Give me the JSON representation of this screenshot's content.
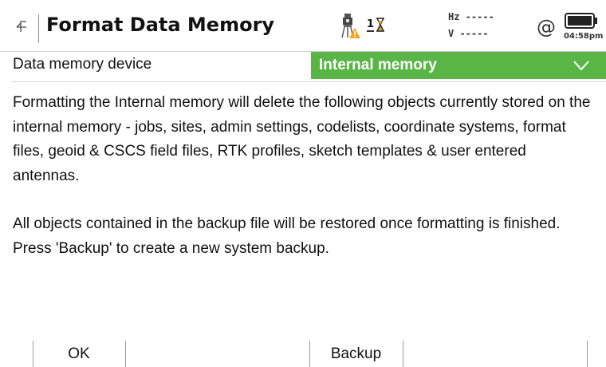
{
  "title_bar": {
    "back_icon": "back-arrow-icon",
    "title": "Format Data Memory",
    "status": {
      "sensor_icon": "instrument-warning-icon",
      "count": "1",
      "hourglass_icon": "hourglass-icon",
      "hz_label": "Hz -----",
      "v_label": "V  -----",
      "at_symbol": "@",
      "battery_icon": "battery-icon",
      "time": "04:58pm"
    }
  },
  "field": {
    "label": "Data memory device",
    "value": "Internal memory",
    "chevron_icon": "chevron-down-icon"
  },
  "message": {
    "paragraph1": "Formatting the Internal memory will delete the following objects currently stored on the internal memory - jobs, sites, admin settings, codelists, coordinate systems, format files, geoid & CSCS field files, RTK profiles, sketch templates & user entered antennas.",
    "paragraph2": "All objects contained in the backup file will be restored once formatting is finished. Press 'Backup' to create a new system backup."
  },
  "softkeys": {
    "ok": "OK",
    "backup": "Backup"
  },
  "colors": {
    "accent_green": "#5ab547",
    "warning": "#f5a623",
    "text": "#111111"
  }
}
